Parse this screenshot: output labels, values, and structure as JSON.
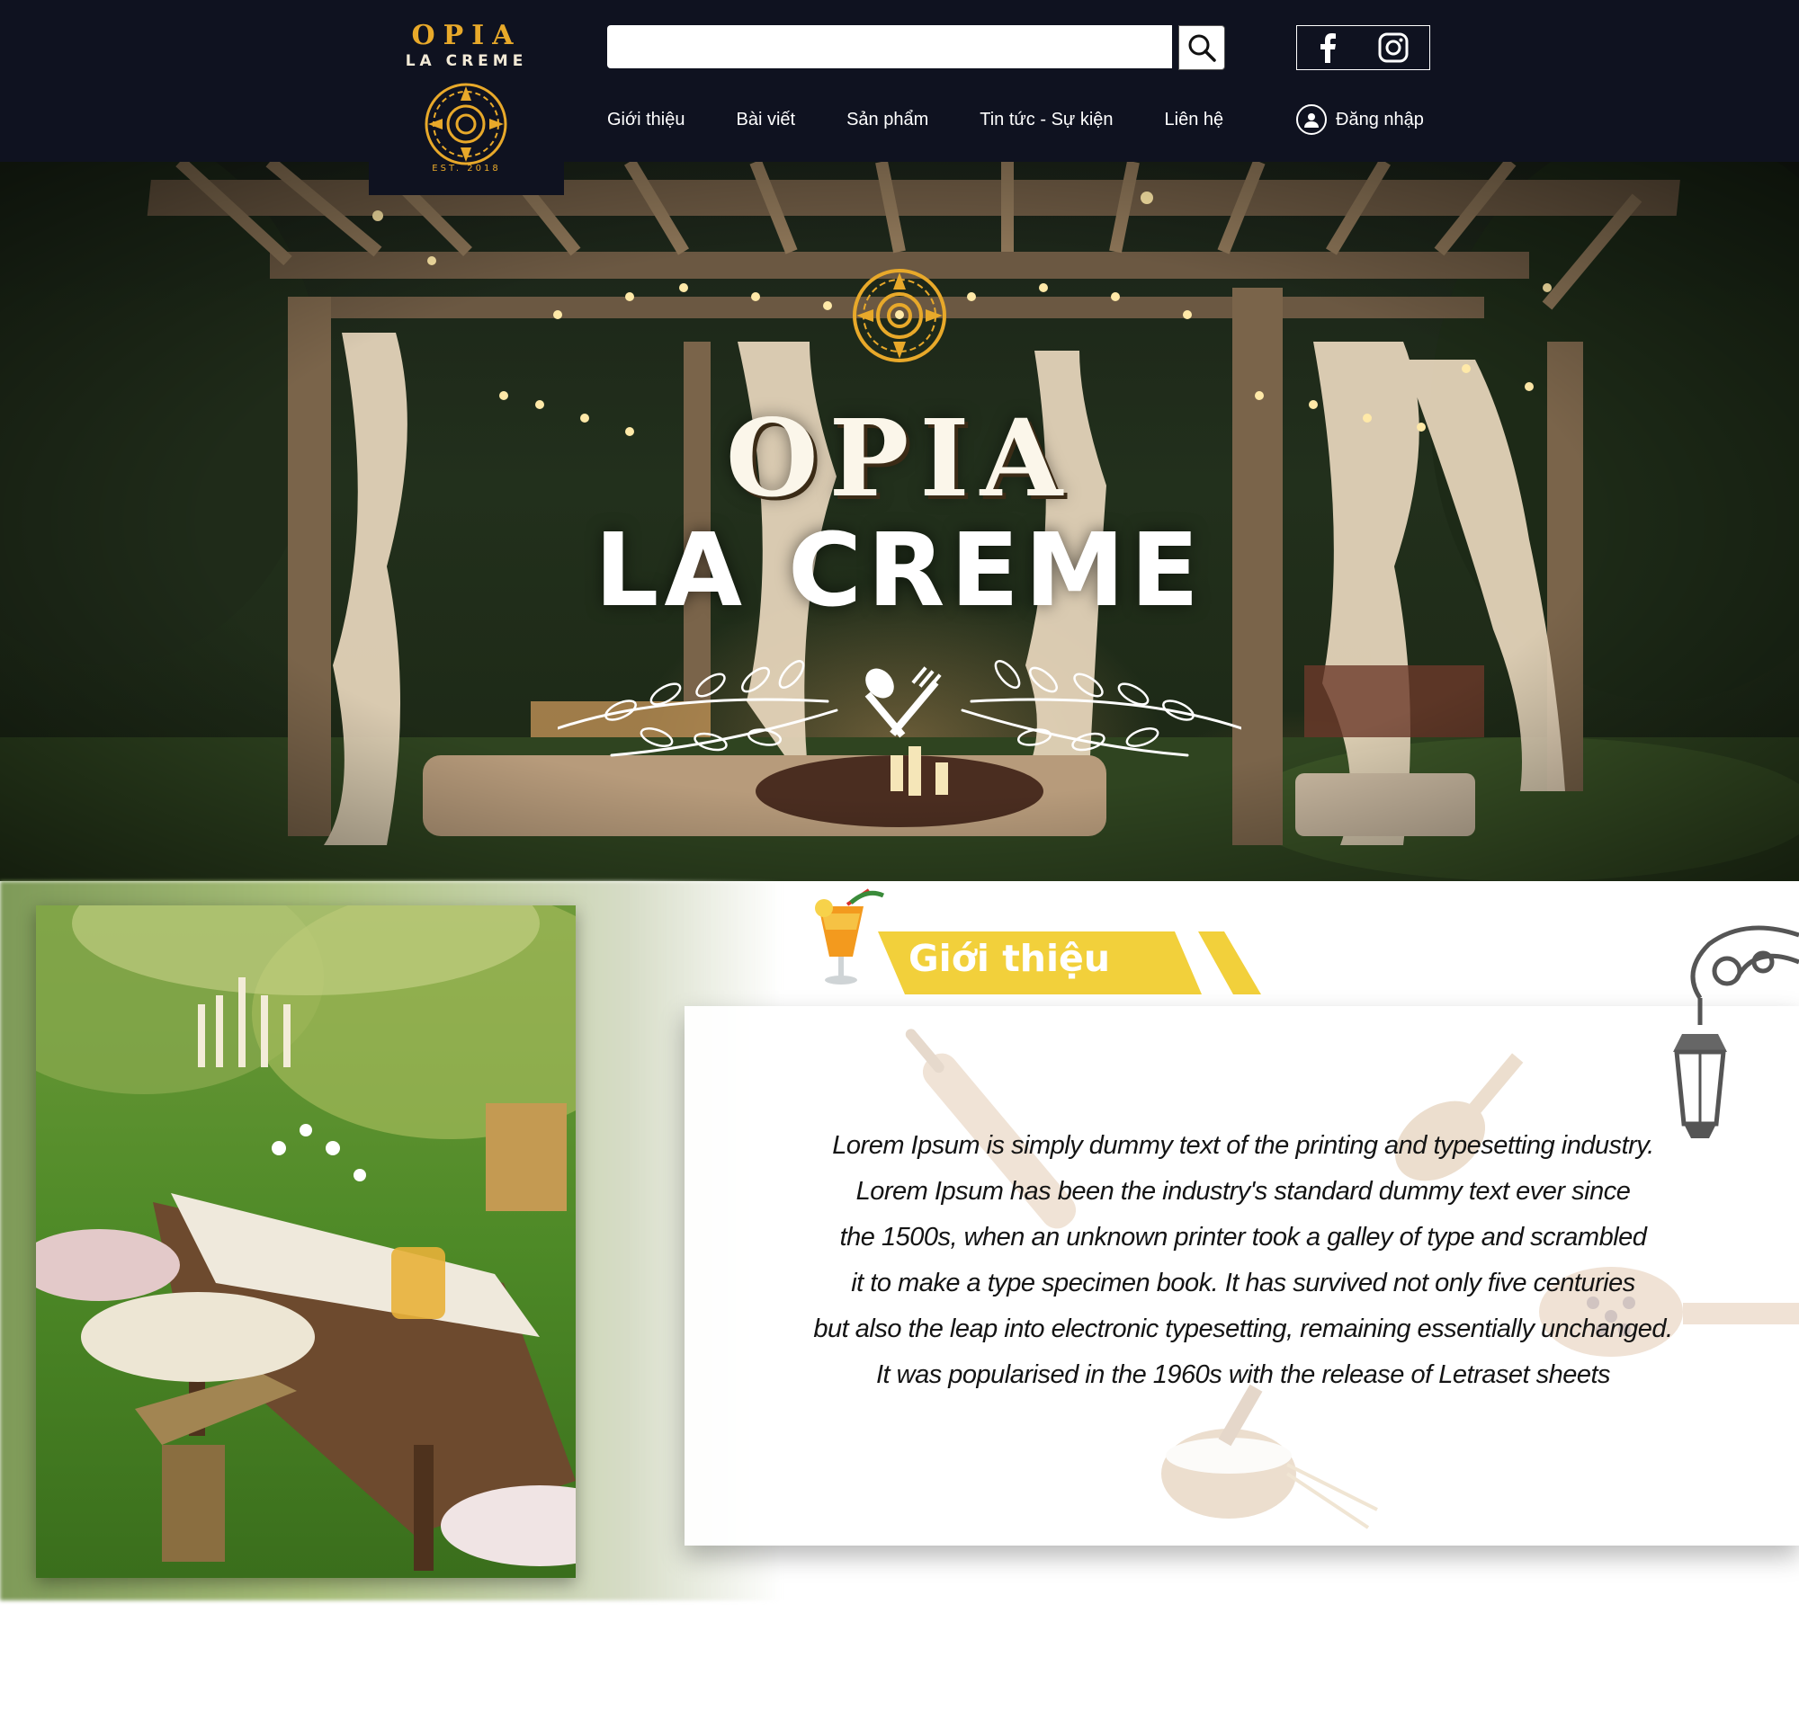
{
  "brand": {
    "name": "OPIA",
    "subtitle": "LA CREME",
    "est": "EST. 2018"
  },
  "search": {
    "value": "",
    "placeholder": "",
    "icon": "search-icon"
  },
  "social": [
    {
      "name": "facebook",
      "icon": "facebook-icon"
    },
    {
      "name": "instagram",
      "icon": "instagram-icon"
    }
  ],
  "nav": [
    {
      "label": "Giới thiệu"
    },
    {
      "label": "Bài viết"
    },
    {
      "label": "Sản phẩm"
    },
    {
      "label": "Tin tức - Sự kiện"
    },
    {
      "label": "Liên hệ"
    }
  ],
  "login": {
    "label": "Đăng nhập",
    "icon": "user-icon"
  },
  "hero": {
    "title": "OPIA",
    "subtitle": "LA CREME",
    "emblem_icon": "emblem-icon",
    "divider_icon": "spoon-fork-icon"
  },
  "intro": {
    "section_title": "Giới thiệu",
    "lines": [
      "Lorem Ipsum is simply dummy text of the printing and typesetting industry.",
      "Lorem Ipsum has been the industry's standard dummy text ever since",
      "the 1500s, when an unknown printer took a galley of type and scrambled",
      "it to make a type specimen book. It has survived not only five centuries",
      "but also the leap into electronic typesetting, remaining essentially unchanged.",
      "It was popularised in the 1960s with the release of Letraset sheets"
    ]
  },
  "colors": {
    "header_bg": "#0f1220",
    "gold": "#e8a92a",
    "tag_yellow": "#f2d03b",
    "text_dark": "#141414"
  }
}
